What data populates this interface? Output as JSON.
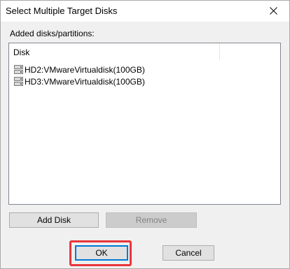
{
  "window": {
    "title": "Select Multiple Target Disks"
  },
  "section": {
    "label": "Added disks/partitions:"
  },
  "list": {
    "column_header": "Disk",
    "rows": [
      {
        "label": "HD2:VMwareVirtualdisk(100GB)",
        "icon": "disk-icon"
      },
      {
        "label": "HD3:VMwareVirtualdisk(100GB)",
        "icon": "disk-icon"
      }
    ]
  },
  "buttons": {
    "add_disk": "Add Disk",
    "remove": "Remove",
    "ok": "OK",
    "cancel": "Cancel"
  },
  "icons": {
    "close": "close-icon"
  },
  "colors": {
    "focus_border": "#0078d7",
    "annotation_highlight": "#e8353b",
    "dialog_background": "#f0f0f0"
  }
}
